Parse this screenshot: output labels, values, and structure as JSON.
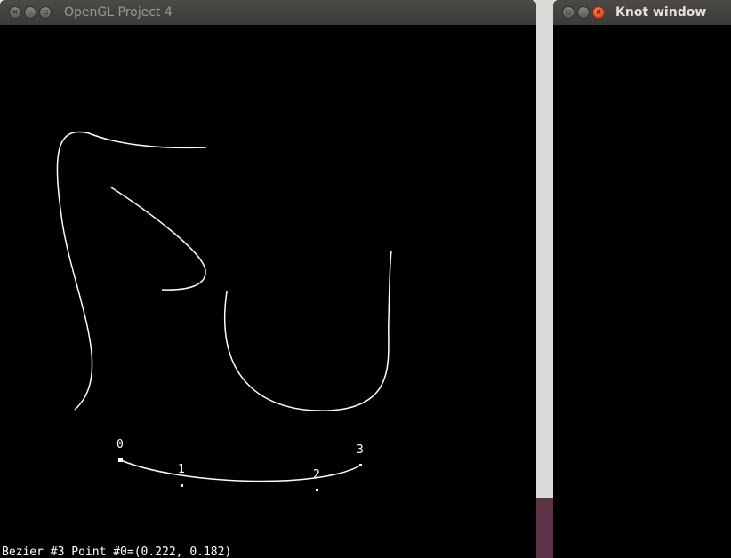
{
  "main_window": {
    "title": "OpenGL Project 4",
    "controls": [
      "minimize",
      "maximize",
      "close"
    ],
    "status": "Bezier #3 Point #0=(0.222, 0.182)",
    "control_point_labels": [
      "0",
      "1",
      "2",
      "3"
    ],
    "curve_color": "#ffffff",
    "background": "#000000"
  },
  "knot_window": {
    "title": "Knot window",
    "controls": [
      "minimize",
      "maximize",
      "close"
    ],
    "background": "#000000"
  },
  "icons": {
    "window_menu": "window-menu-icon",
    "minimize": "minimize-icon",
    "close": "close-icon"
  },
  "colors": {
    "titlebar": "#3c3b37",
    "title_text_inactive": "#9b9890",
    "title_text_active": "#e4e0d8",
    "close_button_active": "#e0491d"
  }
}
